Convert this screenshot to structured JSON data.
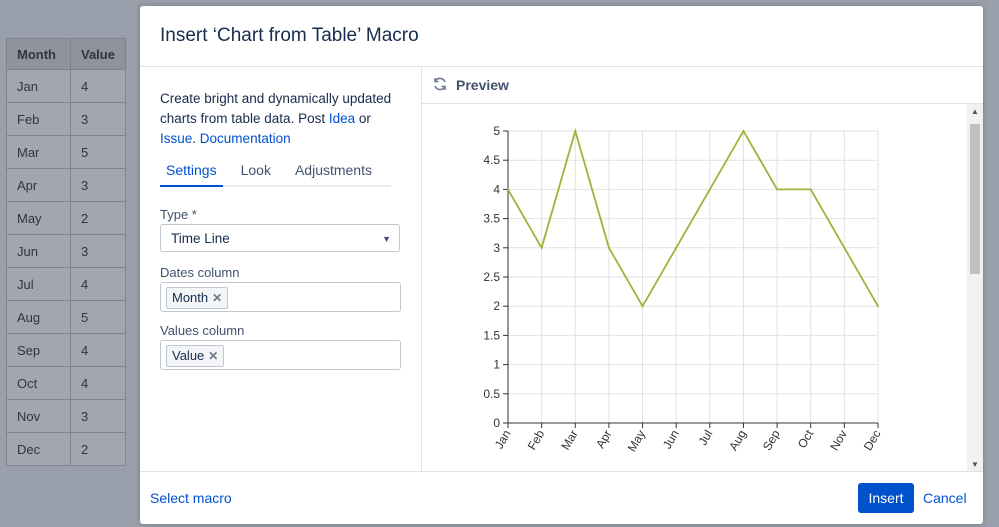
{
  "background_table": {
    "headers": [
      "Month",
      "Value"
    ],
    "rows": [
      [
        "Jan",
        "4"
      ],
      [
        "Feb",
        "3"
      ],
      [
        "Mar",
        "5"
      ],
      [
        "Apr",
        "3"
      ],
      [
        "May",
        "2"
      ],
      [
        "Jun",
        "3"
      ],
      [
        "Jul",
        "4"
      ],
      [
        "Aug",
        "5"
      ],
      [
        "Sep",
        "4"
      ],
      [
        "Oct",
        "4"
      ],
      [
        "Nov",
        "3"
      ],
      [
        "Dec",
        "2"
      ]
    ]
  },
  "dialog": {
    "title": "Insert ‘Chart from Table’ Macro",
    "description_prefix": "Create bright and dynamically updated charts from table data. Post ",
    "idea_link": "Idea",
    "or_text": " or ",
    "issue_link": "Issue",
    "issue_suffix": ". ",
    "documentation_link": "Documentation",
    "tabs": [
      "Settings",
      "Look",
      "Adjustments"
    ],
    "active_tab": "Settings",
    "type_label": "Type *",
    "type_value": "Time Line",
    "dates_label": "Dates column",
    "dates_tag": "Month",
    "values_label": "Values column",
    "values_tag": "Value",
    "preview_label": "Preview",
    "select_macro": "Select macro",
    "insert_button": "Insert",
    "cancel_button": "Cancel"
  },
  "colors": {
    "line": "#9cb43a",
    "accent": "#0052cc"
  },
  "icons": {
    "refresh": "refresh-icon",
    "dropdown": "chevron-down-icon",
    "remove": "close-icon"
  },
  "chart_data": {
    "type": "line",
    "categories": [
      "Jan",
      "Feb",
      "Mar",
      "Apr",
      "May",
      "Jun",
      "Jul",
      "Aug",
      "Sep",
      "Oct",
      "Nov",
      "Dec"
    ],
    "values": [
      4,
      3,
      5,
      3,
      2,
      3,
      4,
      5,
      4,
      4,
      3,
      2
    ],
    "y_ticks": [
      "0",
      "0.5",
      "1",
      "1.5",
      "2",
      "2.5",
      "3",
      "3.5",
      "4",
      "4.5",
      "5"
    ],
    "ylim": [
      0,
      5
    ],
    "grid": true
  }
}
